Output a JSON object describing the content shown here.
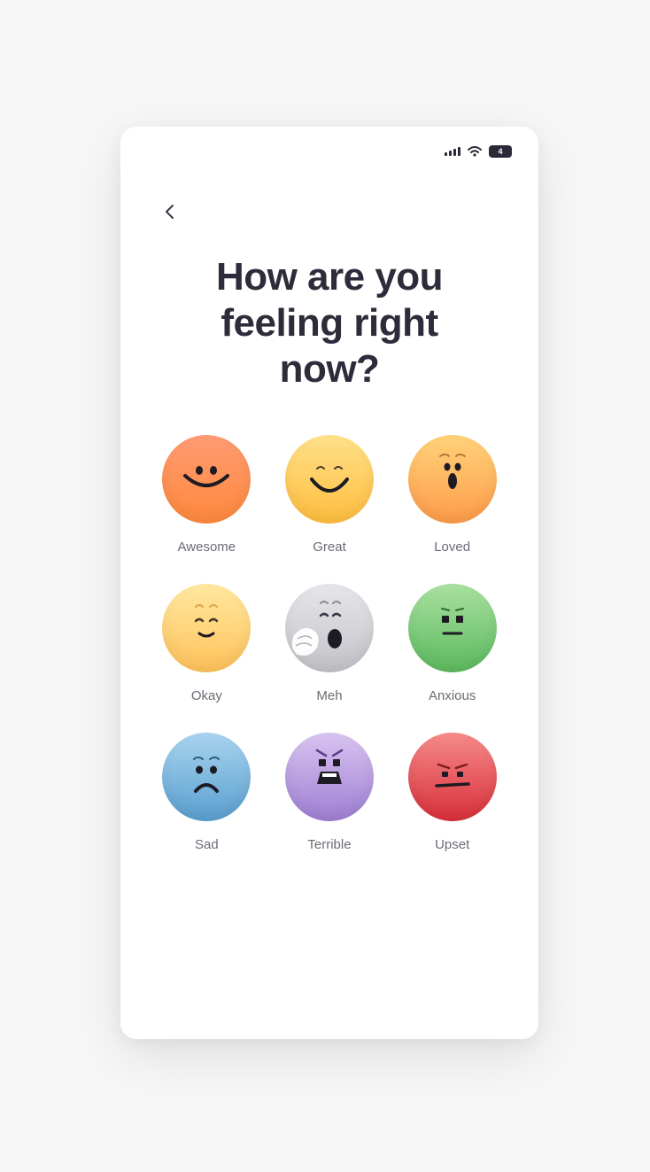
{
  "screen": {
    "title": "How are you feeling right now?"
  },
  "status_bar": {
    "battery_level": "4"
  },
  "icons": {
    "back": "chevron-left-icon",
    "signal": "signal-icon",
    "wifi": "wifi-icon",
    "battery": "battery-icon"
  },
  "moods": [
    {
      "label": "Awesome",
      "face": "awesome-face-icon",
      "color_top": "#ff9a72",
      "color_bottom": "#ff8a3c"
    },
    {
      "label": "Great",
      "face": "great-face-icon",
      "color_top": "#ffe08a",
      "color_bottom": "#ffbe3d"
    },
    {
      "label": "Loved",
      "face": "loved-face-icon",
      "color_top": "#ffd27a",
      "color_bottom": "#ff9c4a"
    },
    {
      "label": "Okay",
      "face": "okay-face-icon",
      "color_top": "#ffe8a0",
      "color_bottom": "#ffc25a"
    },
    {
      "label": "Meh",
      "face": "meh-face-icon",
      "color_top": "#e6e6ea",
      "color_bottom": "#c2c2c8"
    },
    {
      "label": "Anxious",
      "face": "anxious-face-icon",
      "color_top": "#a9e0a0",
      "color_bottom": "#5cba5e"
    },
    {
      "label": "Sad",
      "face": "sad-face-icon",
      "color_top": "#a8d4ee",
      "color_bottom": "#5a9fd0"
    },
    {
      "label": "Terrible",
      "face": "terrible-face-icon",
      "color_top": "#d8c4f0",
      "color_bottom": "#9f7fd4"
    },
    {
      "label": "Upset",
      "face": "upset-face-icon",
      "color_top": "#f58a8a",
      "color_bottom": "#d9303a"
    }
  ]
}
